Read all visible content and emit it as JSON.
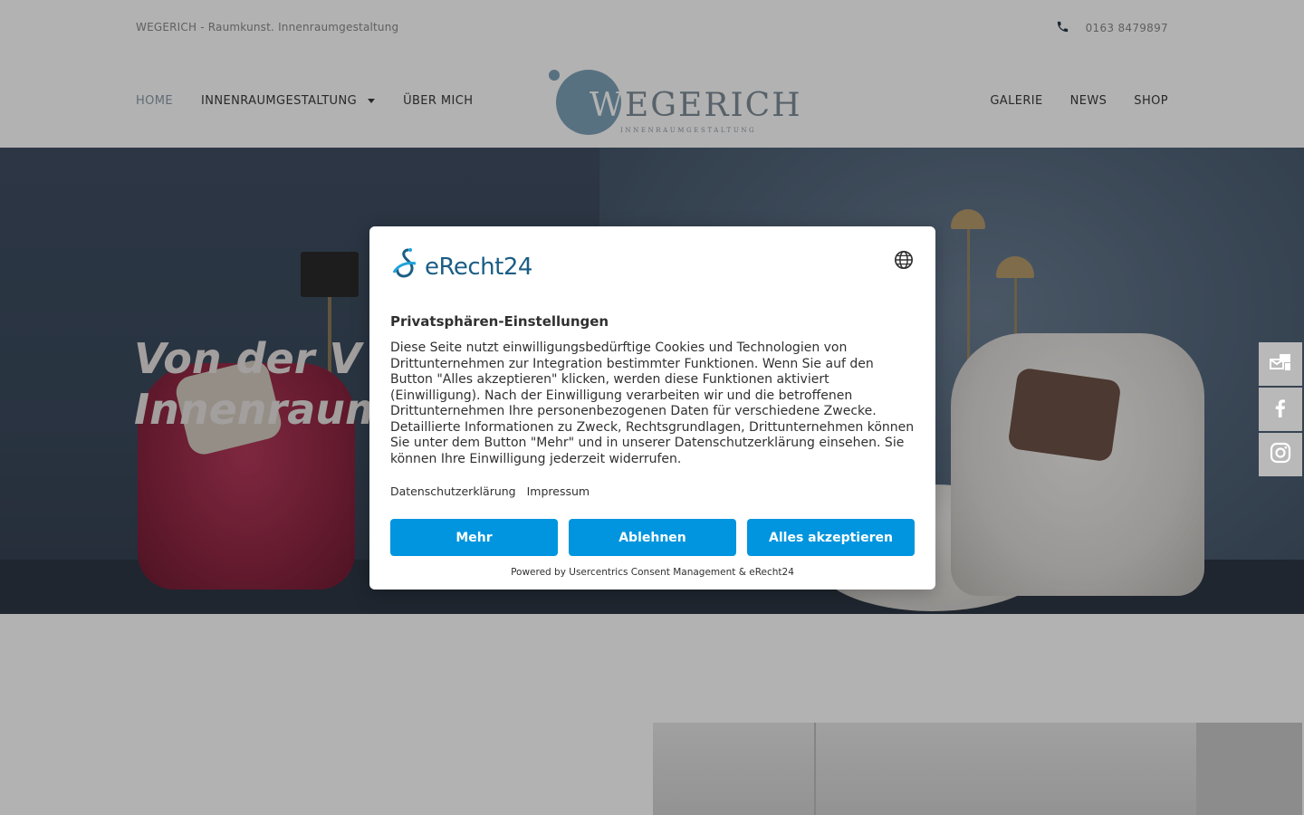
{
  "topbar": {
    "tagline": "WEGERICH - Raumkunst. Innenraumgestaltung",
    "phone": "0163 8479897",
    "phone_icon": "phone-icon"
  },
  "nav": {
    "left": [
      {
        "label": "HOME",
        "active": true
      },
      {
        "label": "INNENRAUMGESTALTUNG",
        "has_dropdown": true
      },
      {
        "label": "ÜBER MICH"
      }
    ],
    "right": [
      {
        "label": "GALERIE"
      },
      {
        "label": "NEWS"
      },
      {
        "label": "SHOP"
      }
    ]
  },
  "logo": {
    "word_first": "W",
    "word_rest": "EGERICH",
    "subtitle": "INNENRAUMGESTALTUNG"
  },
  "hero": {
    "heading": "Von der V\nInnenraum"
  },
  "side_buttons": [
    {
      "icon": "newsletter-icon"
    },
    {
      "icon": "facebook-icon"
    },
    {
      "icon": "instagram-icon"
    }
  ],
  "consent": {
    "brand": "eRecht24",
    "globe_icon": "globe-icon",
    "title": "Privatsphären-Einstellungen",
    "body": "Diese Seite nutzt einwilligungsbedürftige Cookies und Technologien von Drittunternehmen zur Integration bestimmter Funktionen. Wenn Sie auf den Button \"Alles akzeptieren\" klicken, werden diese Funktionen aktiviert (Einwilligung). Nach der Einwilligung verarbeiten wir und die betroffenen Drittunternehmen Ihre personenbezogenen Daten für verschiedene Zwecke. Detaillierte Informationen zu Zweck, Rechtsgrundlagen, Drittunternehmen können Sie unter dem Button \"Mehr\" und in unserer Datenschutzerklärung einsehen. Sie können Ihre Einwilligung jederzeit widerrufen.",
    "links": {
      "privacy": "Datenschutzerklärung",
      "imprint": "Impressum"
    },
    "buttons": {
      "more": "Mehr",
      "decline": "Ablehnen",
      "accept_all": "Alles akzeptieren"
    },
    "powered_by": "Powered by Usercentrics Consent Management & eRecht24"
  },
  "colors": {
    "button_blue": "#0095de",
    "brand_blue": "#1b5e85",
    "logo_blue": "#7fa3b8"
  }
}
